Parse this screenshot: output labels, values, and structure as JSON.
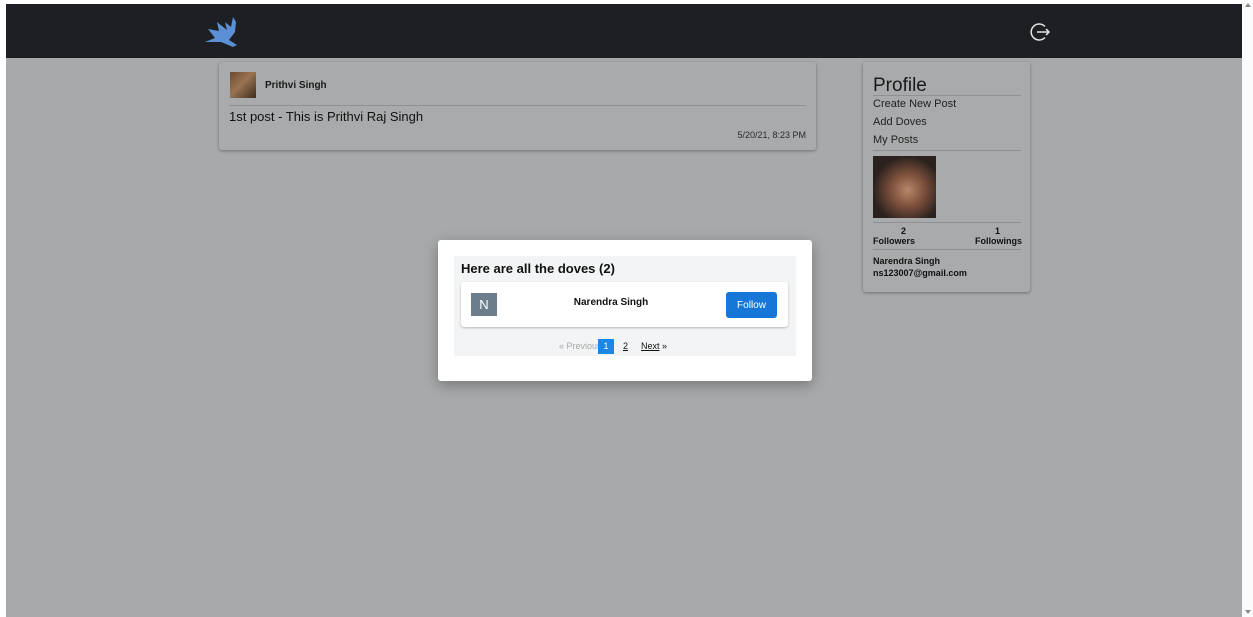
{
  "header": {
    "logo_icon": "dove-logo-icon",
    "logout_icon": "logout-icon"
  },
  "post": {
    "author": "Prithvi Singh",
    "text": "1st post - This is Prithvi Raj Singh",
    "timestamp": "5/20/21, 8:23 PM"
  },
  "profile": {
    "title": "Profile",
    "links": [
      "Create New Post",
      "Add Doves",
      "My Posts"
    ],
    "followers_count": "2",
    "followers_label": "Followers",
    "followings_count": "1",
    "followings_label": "Followings",
    "name": "Narendra Singh",
    "email": "ns123007@gmail.com"
  },
  "modal": {
    "title": "Here are all the doves (2)",
    "doves": [
      {
        "initial": "N",
        "name": "Narendra Singh",
        "action": "Follow"
      }
    ],
    "pagination": {
      "previous": "« Previous",
      "pages": [
        "1",
        "2"
      ],
      "current": "1",
      "next": "Next",
      "next_arrow": "»"
    }
  },
  "colors": {
    "topbar": "#1d1f22",
    "accent": "#1677d9",
    "logo": "#5b8fd6"
  }
}
